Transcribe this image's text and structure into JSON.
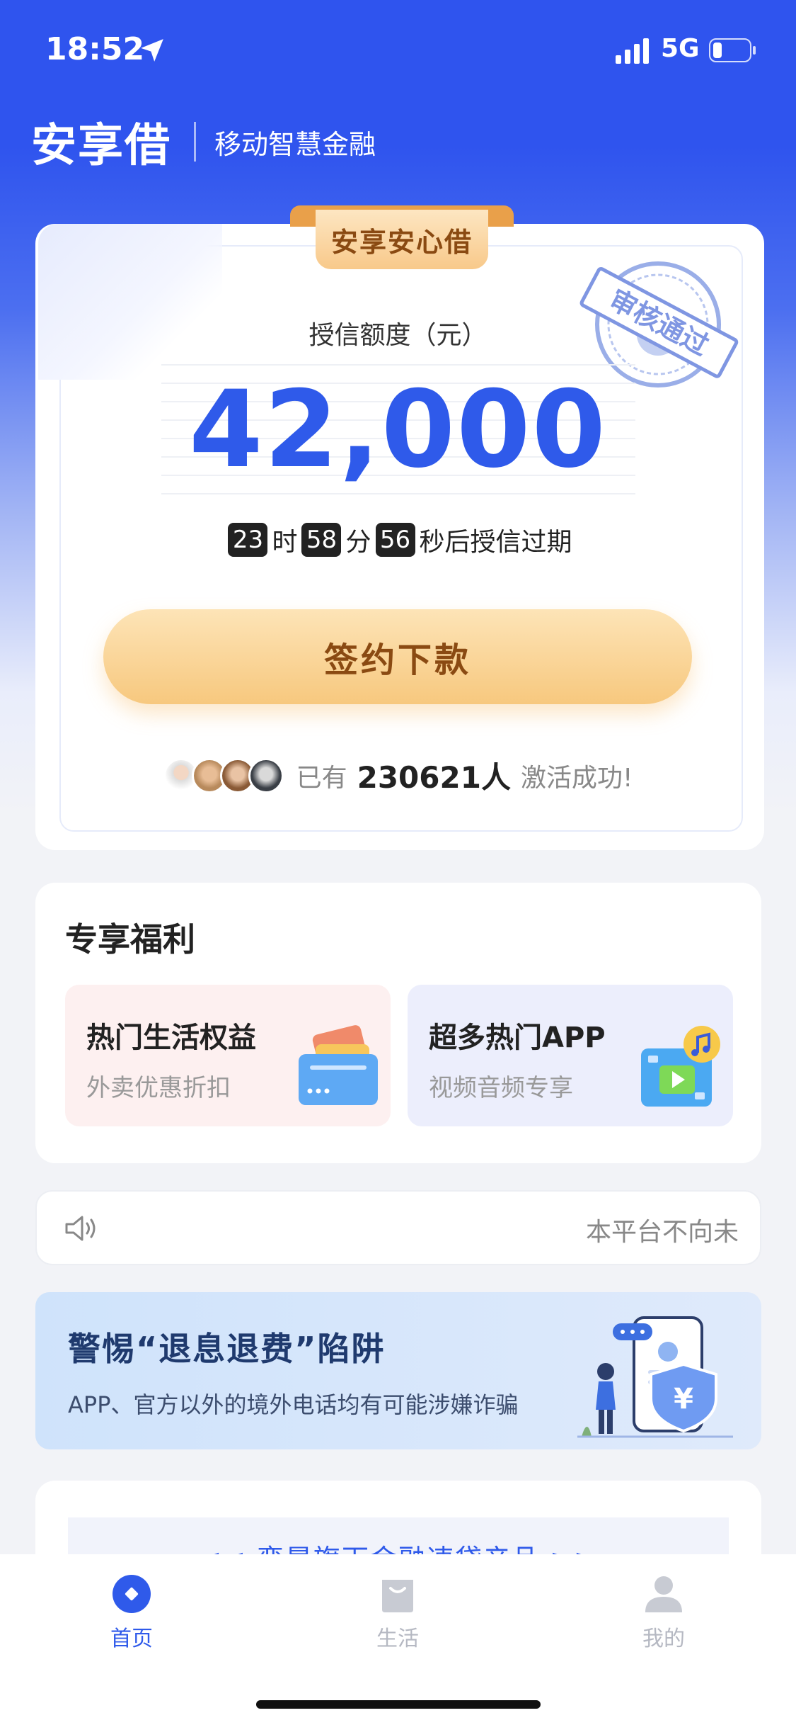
{
  "status_bar": {
    "time": "18:52",
    "network": "5G"
  },
  "header": {
    "app_name": "安享借",
    "slogan": "移动智慧金融"
  },
  "credit_card": {
    "ribbon_label": "安享安心借",
    "stamp_text": "审核通过",
    "credit_label": "授信额度（元）",
    "amount": "42,000",
    "countdown": {
      "hours": "23",
      "hours_unit": "时",
      "minutes": "58",
      "minutes_unit": "分",
      "seconds": "56",
      "suffix": "秒后授信过期"
    },
    "cta_label": "签约下款",
    "activated": {
      "prefix": "已有",
      "count": "230621人",
      "suffix": "激活成功!"
    }
  },
  "benefits": {
    "title": "专享福利",
    "items": [
      {
        "title": "热门生活权益",
        "subtitle": "外卖优惠折扣",
        "icon": "card-wallet-icon"
      },
      {
        "title": "超多热门APP",
        "subtitle": "视频音频专享",
        "icon": "video-music-icon"
      }
    ]
  },
  "notice": {
    "text": "本平台不向未"
  },
  "warning_banner": {
    "title": "警惕“退息退费”陷阱",
    "subtitle": "APP、官方以外的境外电话均有可能涉嫌诈骗"
  },
  "promo": {
    "text": "<< 蛮晨旗下金融速贷产品 >>"
  },
  "tabbar": {
    "items": [
      {
        "label": "首页",
        "icon": "home-icon",
        "active": true
      },
      {
        "label": "生活",
        "icon": "bag-icon",
        "active": false
      },
      {
        "label": "我的",
        "icon": "user-icon",
        "active": false
      }
    ]
  },
  "colors": {
    "brand_blue": "#2f54ee",
    "amount_blue": "#2f5aea",
    "cta_gold": "#f7c87e",
    "cta_text": "#8a4a12"
  }
}
